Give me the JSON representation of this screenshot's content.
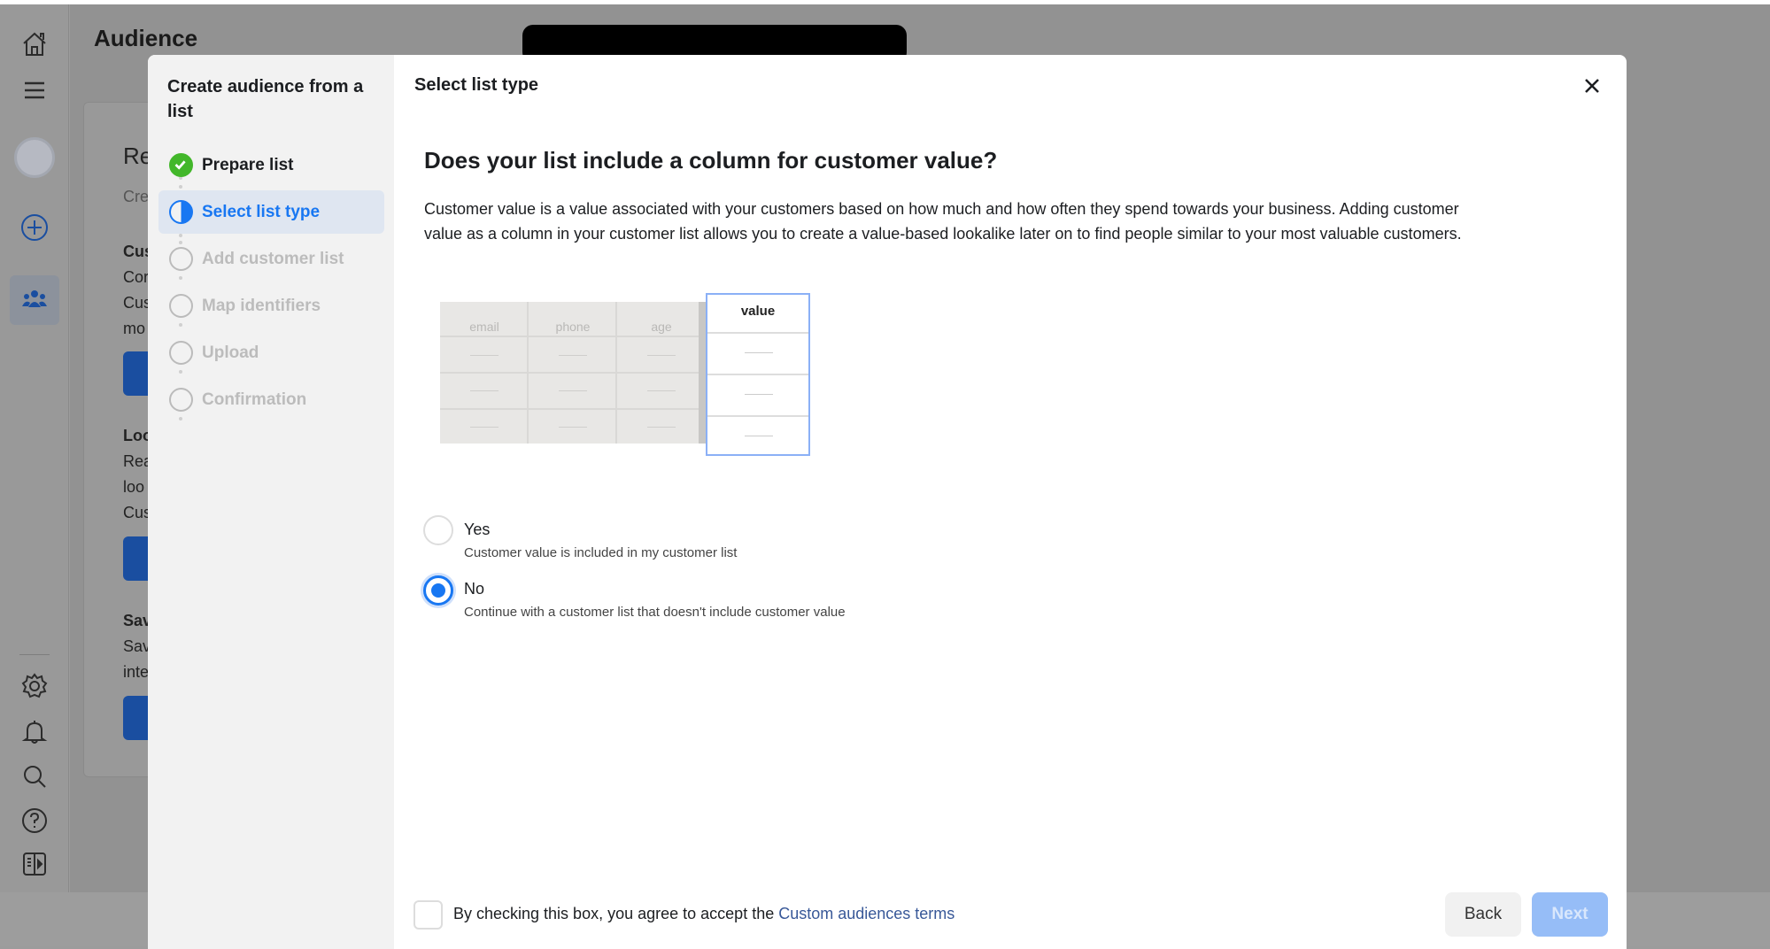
{
  "page": {
    "title": "Audience"
  },
  "background_card": {
    "lines": [
      "Re",
      "Cre",
      "Cus",
      "Cor",
      "Cus",
      "mo",
      "Loo",
      "Rea",
      "loo",
      "Cus",
      "Sav",
      "Sav",
      "inte"
    ]
  },
  "sidebar": {
    "icons": [
      "home-icon",
      "menu-icon",
      "account-avatar",
      "create-icon",
      "audiences-icon",
      "settings-icon",
      "notifications-icon",
      "search-icon",
      "help-icon",
      "panel-icon"
    ]
  },
  "modal": {
    "left_title": "Create audience from a list",
    "steps": [
      {
        "label": "Prepare list",
        "state": "done"
      },
      {
        "label": "Select list type",
        "state": "active"
      },
      {
        "label": "Add customer list",
        "state": "pending"
      },
      {
        "label": "Map identifiers",
        "state": "pending"
      },
      {
        "label": "Upload",
        "state": "pending"
      },
      {
        "label": "Confirmation",
        "state": "pending"
      }
    ],
    "header_title": "Select list type",
    "heading": "Does your list include a column for customer value?",
    "description": "Customer value is a value associated with your customers based on how much and how often they spend towards your business. Adding customer value as a column in your customer list allows you to create a value-based lookalike later on to find people similar to your most valuable customers.",
    "illustration": {
      "columns": [
        "email",
        "phone",
        "age"
      ],
      "highlight_column": "value"
    },
    "options": [
      {
        "label": "Yes",
        "sub": "Customer value is included in my customer list",
        "selected": false
      },
      {
        "label": "No",
        "sub": "Continue with a customer list that doesn't include customer value",
        "selected": true
      }
    ],
    "terms_text": "By checking this box, you agree to accept the ",
    "terms_link": "Custom audiences terms",
    "terms_checked": false,
    "back_label": "Back",
    "next_label": "Next"
  },
  "colors": {
    "accent": "#1877f2",
    "success": "#42b72a",
    "link": "#385898"
  }
}
